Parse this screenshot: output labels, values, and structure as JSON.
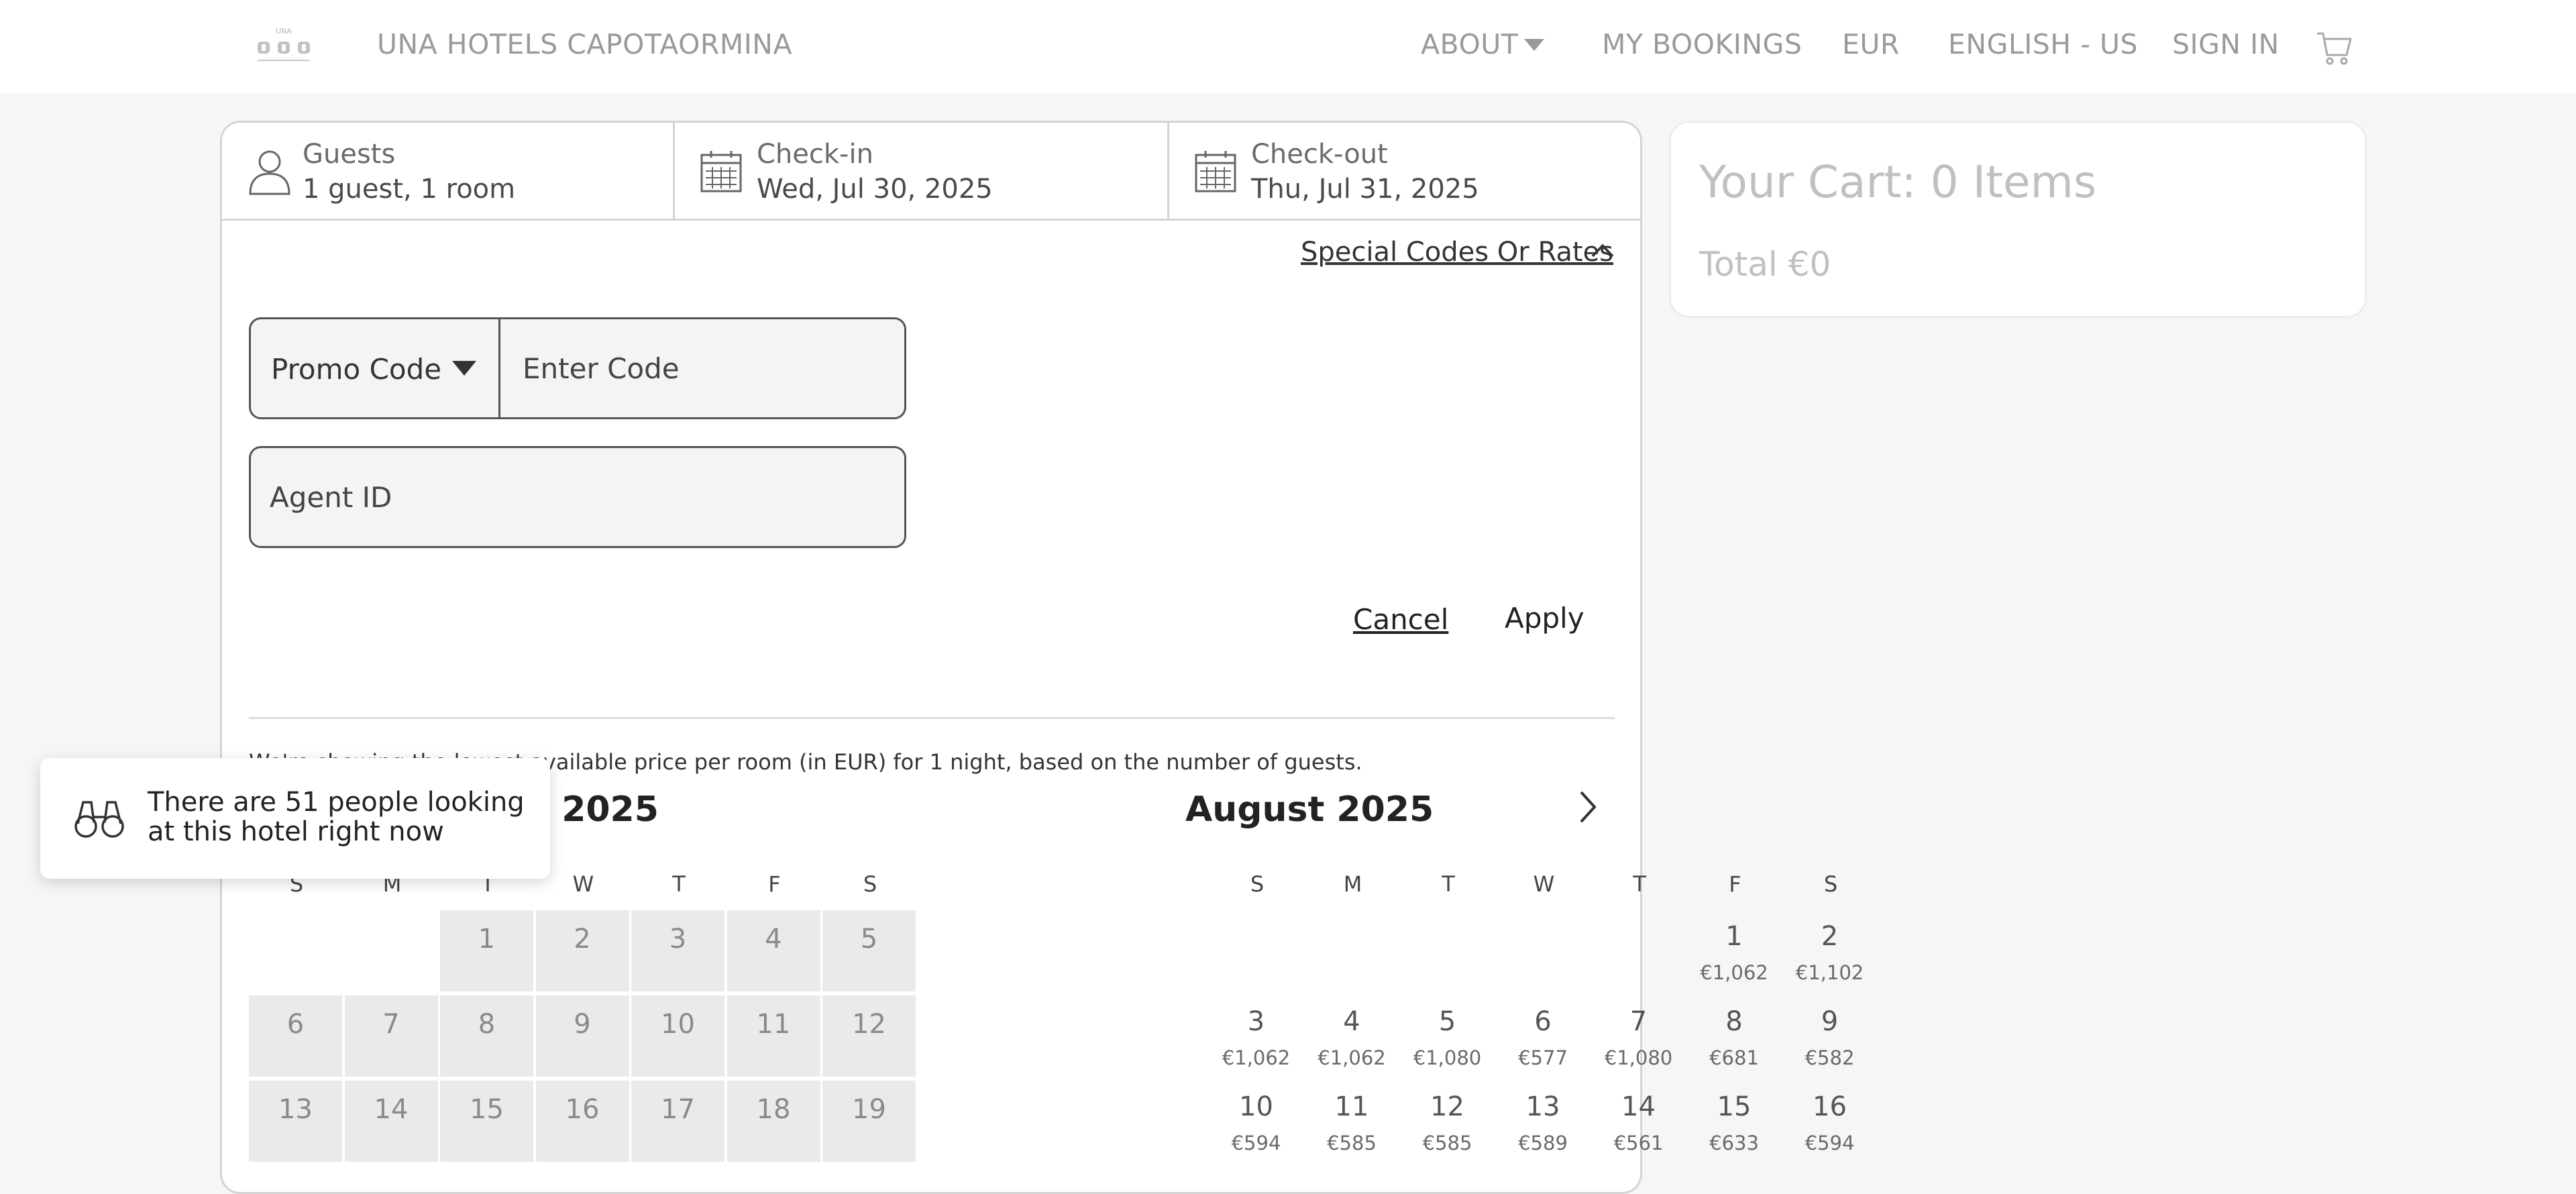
{
  "header": {
    "brand": "UNA HOTELS CAPOTAORMINA",
    "nav": [
      "ABOUT",
      "MY BOOKINGS",
      "EUR",
      "ENGLISH - US",
      "SIGN IN"
    ],
    "icons": {
      "logo": "una-hotels-logo",
      "caret": "caret-down-icon",
      "cart": "shopping-cart-icon"
    }
  },
  "search": {
    "guests_label": "Guests",
    "guests_value": "1 guest, 1 room",
    "checkin_label": "Check-in",
    "checkin_value": "Wed, Jul 30, 2025",
    "checkout_label": "Check-out",
    "checkout_value": "Thu, Jul 31, 2025"
  },
  "special_codes": {
    "link": "Special Codes Or Rates",
    "promo_select": "Promo Code",
    "code_placeholder": "Enter Code",
    "agent_placeholder": "Agent ID",
    "cancel": "Cancel",
    "apply": "Apply"
  },
  "calendar": {
    "note": "We're showing the lowest available price per room (in EUR) for 1 night, based on the number of guests.",
    "weekdays": [
      "S",
      "M",
      "T",
      "W",
      "T",
      "F",
      "S"
    ],
    "months": [
      {
        "title": "July 2025",
        "days": [
          [
            null,
            null,
            "1",
            "2",
            "3",
            "4",
            "5"
          ],
          [
            "6",
            "7",
            "8",
            "9",
            "10",
            "11",
            "12"
          ],
          [
            "13",
            "14",
            "15",
            "16",
            "17",
            "18",
            "19"
          ]
        ]
      },
      {
        "title": "August 2025",
        "days": [
          [
            null,
            null,
            null,
            null,
            null,
            {
              "d": "1",
              "p": "€1,062"
            },
            {
              "d": "2",
              "p": "€1,102"
            }
          ],
          [
            {
              "d": "3",
              "p": "€1,062"
            },
            {
              "d": "4",
              "p": "€1,062"
            },
            {
              "d": "5",
              "p": "€1,080"
            },
            {
              "d": "6",
              "p": "€577"
            },
            {
              "d": "7",
              "p": "€1,080"
            },
            {
              "d": "8",
              "p": "€681"
            },
            {
              "d": "9",
              "p": "€582"
            }
          ],
          [
            {
              "d": "10",
              "p": "€594"
            },
            {
              "d": "11",
              "p": "€585"
            },
            {
              "d": "12",
              "p": "€585"
            },
            {
              "d": "13",
              "p": "€589"
            },
            {
              "d": "14",
              "p": "€561"
            },
            {
              "d": "15",
              "p": "€633"
            },
            {
              "d": "16",
              "p": "€594"
            }
          ]
        ]
      }
    ]
  },
  "cart": {
    "title": "Your Cart: 0 Items",
    "total": "Total €0"
  },
  "toast": {
    "text": "There are 51 people looking at this hotel right now"
  }
}
